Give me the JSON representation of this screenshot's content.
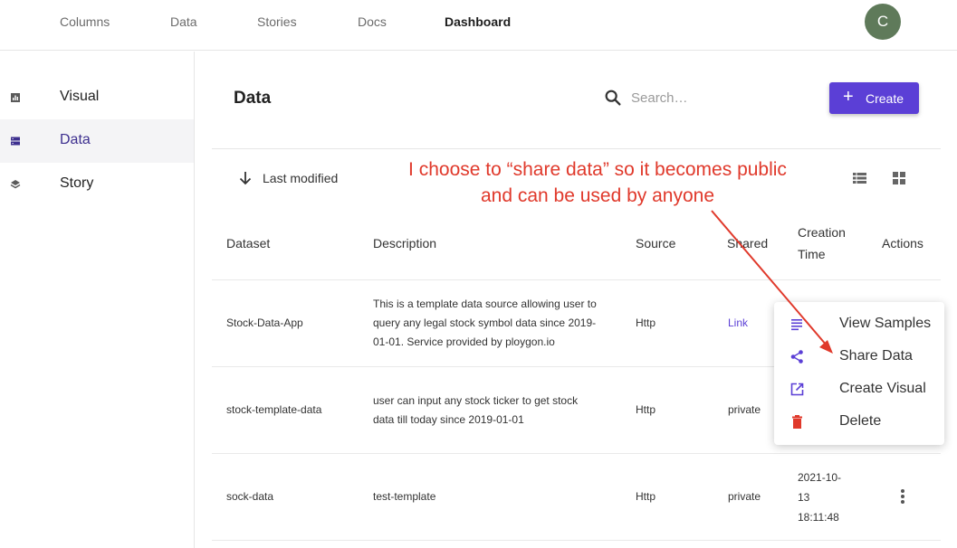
{
  "nav": {
    "items": [
      "Columns",
      "Data",
      "Stories",
      "Docs",
      "Dashboard"
    ],
    "active": "Dashboard",
    "avatar_initial": "C"
  },
  "sidebar": {
    "items": [
      {
        "label": "Visual",
        "icon": "bar-chart-icon"
      },
      {
        "label": "Data",
        "icon": "database-icon"
      },
      {
        "label": "Story",
        "icon": "layers-icon"
      }
    ],
    "active": "Data"
  },
  "main": {
    "title": "Data",
    "search_placeholder": "Search…",
    "create_label": "Create",
    "sort_label": "Last modified"
  },
  "table": {
    "headers": {
      "dataset": "Dataset",
      "description": "Description",
      "source": "Source",
      "shared": "Shared",
      "creation_time": "Creation Time",
      "actions": "Actions"
    },
    "rows": [
      {
        "dataset": "Stock-Data-App",
        "description": "This is a template data source allowing user to query any legal stock symbol data since 2019-01-01. Service provided by ploygon.io",
        "source": "Http",
        "shared": "Link",
        "creation_time": ""
      },
      {
        "dataset": "stock-template-data",
        "description": "user can input any stock ticker to get stock data till today since 2019-01-01",
        "source": "Http",
        "shared": "private",
        "creation_time": ""
      },
      {
        "dataset": "sock-data",
        "description": "test-template",
        "source": "Http",
        "shared": "private",
        "creation_time": "2021-10-13 18:11:48"
      }
    ]
  },
  "menu": {
    "items": [
      {
        "label": "View Samples",
        "icon": "list-icon",
        "color": "#5b3fd6"
      },
      {
        "label": "Share Data",
        "icon": "share-icon",
        "color": "#5b3fd6"
      },
      {
        "label": "Create Visual",
        "icon": "external-link-icon",
        "color": "#5b3fd6"
      },
      {
        "label": "Delete",
        "icon": "trash-icon",
        "color": "#e0392b"
      }
    ]
  },
  "annotation": {
    "line1": "I choose to “share data” so it becomes public",
    "line2": "and can be used by anyone",
    "color": "#e0392b"
  },
  "colors": {
    "accent": "#5b3fd6",
    "avatar": "#5f7a5a",
    "annotation": "#e0392b"
  }
}
